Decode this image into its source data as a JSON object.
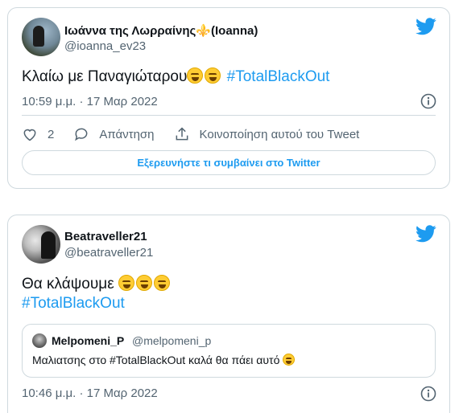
{
  "tweets": [
    {
      "display_name": "Ιωάννα της Λωρραίνης⚜️(Ioanna)",
      "handle": "@ioanna_ev23",
      "text_prefix": "Κλαίω με Παναγιώταρου",
      "hashtag": "#TotalBlackOut",
      "timestamp": "10:59 μ.μ. · 17 Μαρ 2022",
      "like_count": "2",
      "reply_label": "Απάντηση",
      "share_label": "Κοινοποίηση αυτού του Tweet",
      "explore_label": "Εξερευνήστε τι συμβαίνει στο Twitter"
    },
    {
      "display_name": "Beatraveller21",
      "handle": "@beatraveller21",
      "text_prefix": "Θα κλάψουμε",
      "hashtag": "#TotalBlackOut",
      "timestamp": "10:46 μ.μ. · 17 Μαρ 2022",
      "quote": {
        "name": "Melpomeni_P",
        "handle": "@melpomeni_p",
        "text": "Μαλιατσης στο #TotalBlackOut καλά θα πάει αυτό"
      }
    }
  ],
  "colors": {
    "accent": "#1d9bf0",
    "text": "#0f1419",
    "secondary": "#536471",
    "border": "#cfd9de"
  },
  "icons": [
    "twitter-bird-icon",
    "info-icon",
    "heart-icon",
    "reply-icon",
    "share-icon",
    "laughing-emoji-icon",
    "rofl-emoji-icon"
  ]
}
